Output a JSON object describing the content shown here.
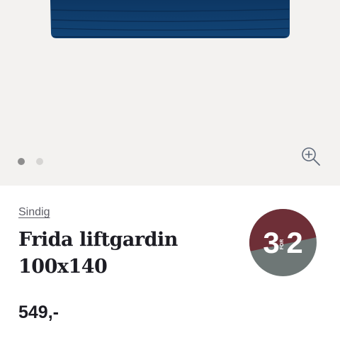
{
  "gallery": {
    "slide_count": 2,
    "active_slide": 1,
    "zoom_icon": "zoom-in-icon"
  },
  "product": {
    "brand": "Sindig",
    "title_line1": "Frida liftgardin",
    "title_line2": "100x140",
    "price": "549,-"
  },
  "promo_badge": {
    "big_left": "3",
    "small": "FOR",
    "big_right": "2",
    "color_top": "#6e2f37",
    "color_bottom": "#6e7776"
  },
  "colors": {
    "curtain": "#0f3f6e",
    "gallery_bg": "#f3f2f0",
    "text": "#1d1d24"
  }
}
